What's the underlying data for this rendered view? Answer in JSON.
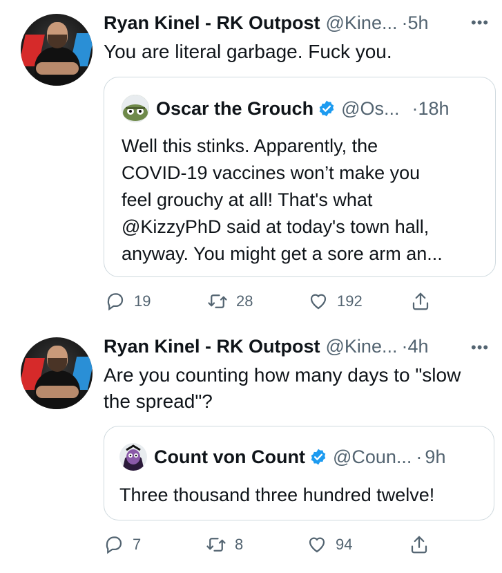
{
  "tweets": [
    {
      "author_name": "Ryan Kinel - RK Outpost",
      "author_handle": "@Kine...",
      "dot": "·",
      "time": "5h",
      "more": "•••",
      "text": "You are literal garbage. Fuck you.",
      "quote": {
        "author_name": "Oscar the Grouch",
        "author_handle": "@Os...",
        "dot": "·",
        "time": "18h",
        "text_lines": [
          "Well this stinks. Apparently, the",
          "COVID-19 vaccines won’t make you",
          "feel grouchy at all! That's what",
          "@KizzyPhD said at today's town hall,",
          "anyway. You might get a sore arm an..."
        ]
      },
      "actions": {
        "replies": "19",
        "retweets": "28",
        "likes": "192"
      }
    },
    {
      "author_name": "Ryan Kinel - RK Outpost",
      "author_handle": "@Kine...",
      "dot": "·",
      "time": "4h",
      "more": "•••",
      "text_lines": [
        "Are you counting how many days to \"slow",
        "the spread\"?"
      ],
      "quote": {
        "author_name": "Count von Count",
        "author_handle": "@Coun...",
        "dot": "·",
        "time": "9h",
        "text_lines": [
          "Three thousand three hundred twelve!"
        ]
      },
      "actions": {
        "replies": "7",
        "retweets": "8",
        "likes": "94"
      }
    }
  ],
  "colors": {
    "verified": "#1d9bf0",
    "secondary_text": "#536471",
    "border": "#cfd9de"
  }
}
